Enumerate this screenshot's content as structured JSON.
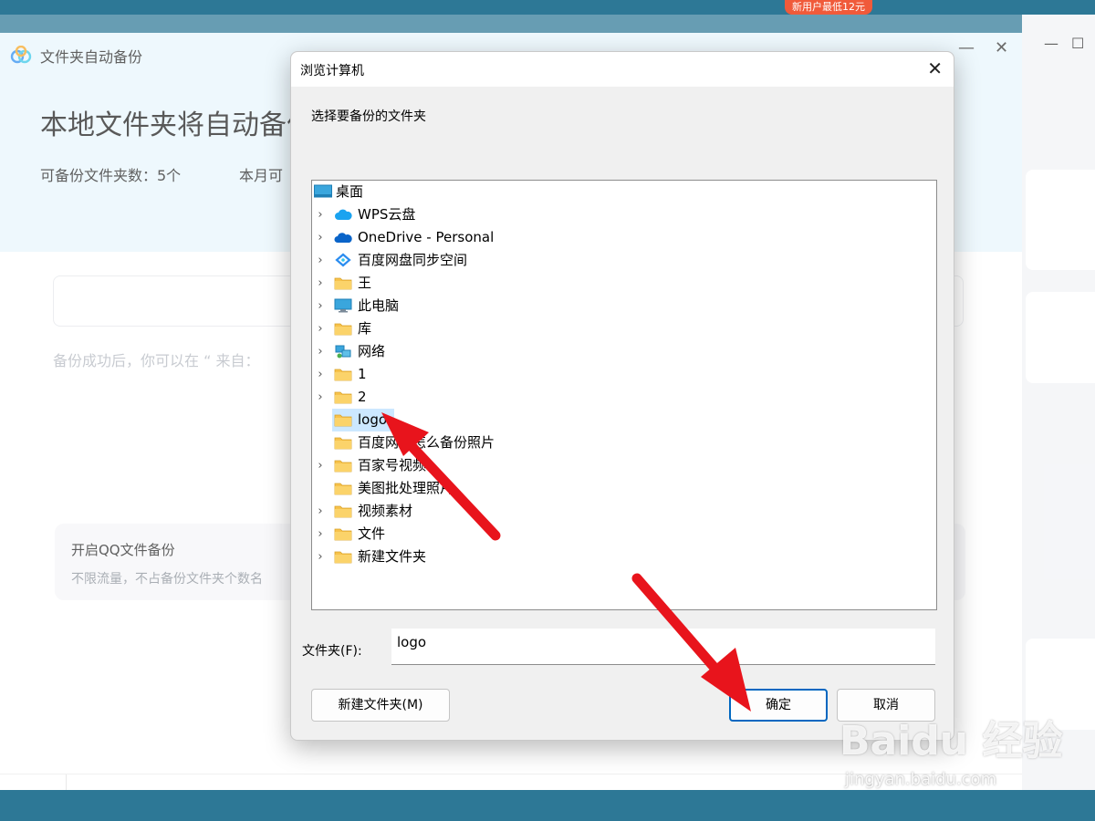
{
  "top_strip": {
    "promo_badge": "新用户最低12元"
  },
  "main_window": {
    "title": "文件夹自动备份",
    "heading": "本地文件夹将自动备份",
    "stat_folders": "可备份文件夹数：5个",
    "stat_month": "本月可",
    "hint": "备份成功后，你可以在 “ 来自：",
    "qq_title": "开启QQ文件备份",
    "qq_desc": "不限流量，不占备份文件夹个数名",
    "minimize_glyph": "—",
    "close_glyph": "✕"
  },
  "right_app": {
    "minimize_glyph": "—",
    "maximize_glyph": "☐"
  },
  "dialog": {
    "title": "浏览计算机",
    "close_glyph": "✕",
    "instruction": "选择要备份的文件夹",
    "root": "桌面",
    "items": [
      {
        "label": "WPS云盘",
        "expandable": true,
        "icon": "cloud-blue-icon"
      },
      {
        "label": "OneDrive - Personal",
        "expandable": true,
        "icon": "onedrive-icon"
      },
      {
        "label": "百度网盘同步空间",
        "expandable": true,
        "icon": "baidu-sync-icon"
      },
      {
        "label": "王",
        "expandable": true,
        "icon": "folder-icon"
      },
      {
        "label": "此电脑",
        "expandable": true,
        "icon": "computer-icon"
      },
      {
        "label": "库",
        "expandable": true,
        "icon": "folder-icon"
      },
      {
        "label": "网络",
        "expandable": true,
        "icon": "network-icon"
      },
      {
        "label": "1",
        "expandable": true,
        "icon": "folder-icon"
      },
      {
        "label": "2",
        "expandable": true,
        "icon": "folder-icon"
      },
      {
        "label": "logo",
        "expandable": false,
        "icon": "folder-icon",
        "selected": true
      },
      {
        "label": "百度网盘怎么备份照片",
        "expandable": false,
        "icon": "folder-icon"
      },
      {
        "label": "百家号视频",
        "expandable": true,
        "icon": "folder-icon"
      },
      {
        "label": "美图批处理照片",
        "expandable": false,
        "icon": "folder-icon"
      },
      {
        "label": "视频素材",
        "expandable": true,
        "icon": "folder-icon"
      },
      {
        "label": "文件",
        "expandable": true,
        "icon": "folder-icon"
      },
      {
        "label": "新建文件夹",
        "expandable": true,
        "icon": "folder-icon"
      }
    ],
    "folder_label": "文件夹(F):",
    "folder_value": "logo",
    "new_folder_button": "新建文件夹(M)",
    "ok_button": "确定",
    "cancel_button": "取消"
  },
  "watermark": {
    "brand": "Baidu 经验",
    "url": "jingyan.baidu.com"
  },
  "colors": {
    "accent_blue": "#0067c0",
    "selection": "#cce8ff",
    "hero_bg": "#e8f6fc",
    "arrow_red": "#e8141c",
    "folder_yellow": "#f7c24b"
  }
}
